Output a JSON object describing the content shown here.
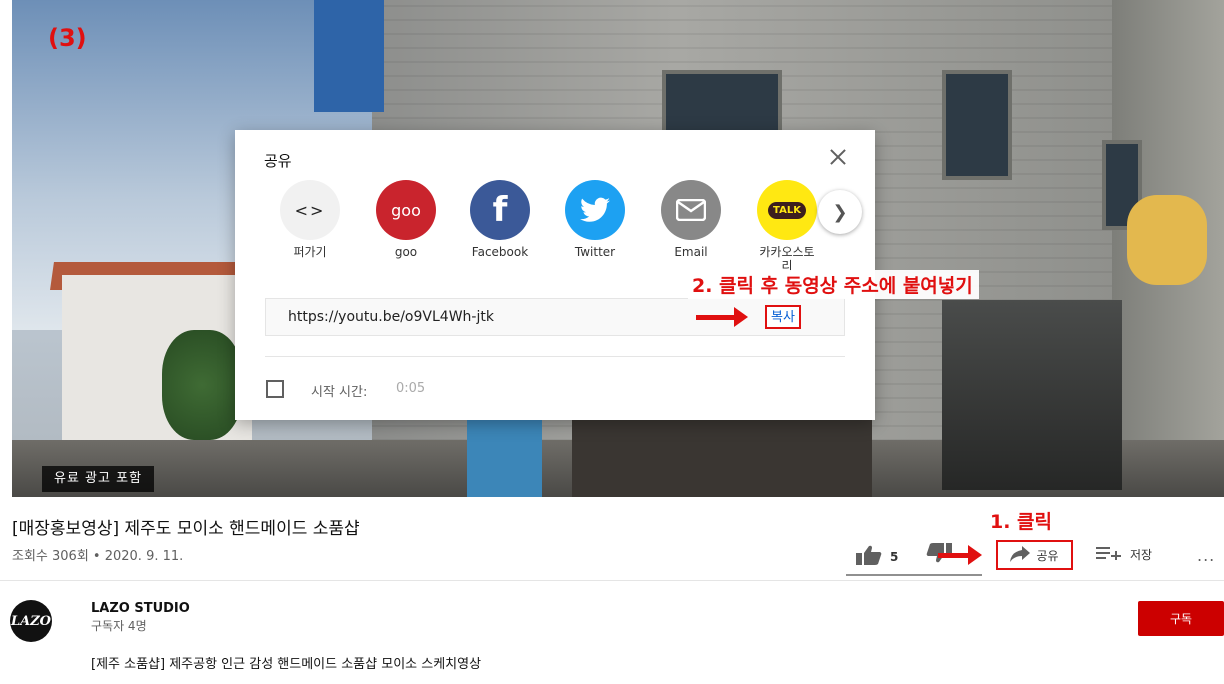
{
  "step_label": "(3)",
  "paid_badge": "유료 광고 포함",
  "share_dialog": {
    "title": "공유",
    "items": [
      {
        "label": "퍼가기",
        "icon": "embed-icon",
        "glyph": "<>"
      },
      {
        "label": "goo",
        "icon": "goo-icon",
        "glyph": "goo"
      },
      {
        "label": "Facebook",
        "icon": "facebook-icon",
        "glyph": "f"
      },
      {
        "label": "Twitter",
        "icon": "twitter-icon"
      },
      {
        "label": "Email",
        "icon": "email-icon"
      },
      {
        "label": "카카오스토\n리",
        "icon": "kakaostory-icon",
        "glyph": "TALK"
      }
    ],
    "next_icon": "chevron-right-icon",
    "url": "https://youtu.be/o9VL4Wh-jtk",
    "copy_label": "복사",
    "start_time_label": "시작 시간:",
    "start_time_value": "0:05"
  },
  "annotations": {
    "step2": "2. 클릭 후 동영상 주소에 붙여넣기",
    "step1": "1. 클릭",
    "color": "#e01010"
  },
  "video": {
    "title": "[매장홍보영상] 제주도 모이소 핸드메이드 소품샵",
    "meta": "조회수 306회 • 2020. 9. 11.",
    "likes": "5",
    "share_label": "공유",
    "save_label": "저장",
    "more_glyph": "..."
  },
  "channel": {
    "avatar_text": "LAZO",
    "name": "LAZO STUDIO",
    "subscribers": "구독자 4명",
    "subscribe_label": "구독",
    "subscribe_color": "#cc0000"
  },
  "description": "[제주 소품샵] 제주공항 인근 감성 핸드메이드 소품샵 모이소 스케치영상"
}
